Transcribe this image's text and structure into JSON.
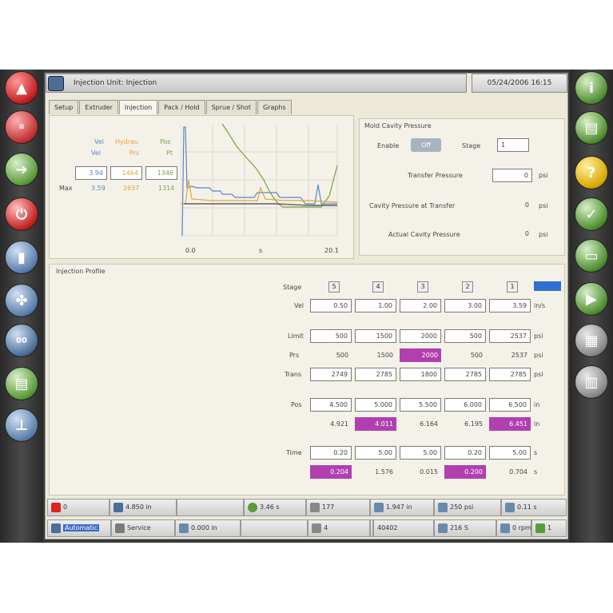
{
  "window": {
    "title": "Injection Unit: Injection",
    "datetime": "05/24/2006 16:15"
  },
  "tabs": [
    "Setup",
    "Extruder",
    "Injection",
    "Pack / Hold",
    "Sprue / Shot",
    "Graphs"
  ],
  "graph": {
    "legend_row1": [
      "Vel",
      "Hydrau",
      "Pos"
    ],
    "legend_row2": [
      "Vel",
      "Prs",
      "Pt"
    ],
    "values": [
      "3.94",
      "1464",
      "1346"
    ],
    "max_label": "Max",
    "max_values": [
      "3.59",
      "2637",
      "1314"
    ],
    "x_labels": [
      "0.0",
      "s",
      "20.1"
    ]
  },
  "cavity": {
    "title": "Mold Cavity Pressure",
    "enable_label": "Enable",
    "enable_value": "Off",
    "stage_label": "Stage",
    "stage_value": "1",
    "transfer_label": "Transfer Pressure",
    "transfer_value": "0",
    "transfer_unit": "psi",
    "at_transfer_label": "Cavity Pressure at Transfer",
    "at_transfer_value": "0",
    "at_transfer_unit": "psi",
    "actual_label": "Actual Cavity Pressure",
    "actual_value": "0",
    "actual_unit": "psi"
  },
  "profile": {
    "title": "Injection Profile",
    "stage_label": "Stage",
    "stages": [
      "5",
      "4",
      "3",
      "2",
      "1"
    ],
    "vel": {
      "label": "Vel",
      "unit": "in/s",
      "values": [
        "0.50",
        "1.00",
        "2.00",
        "3.00",
        "3.59"
      ]
    },
    "limit": {
      "label": "Limit",
      "unit": "psi",
      "values": [
        "500",
        "1500",
        "2000",
        "500",
        "2537"
      ]
    },
    "prs": {
      "label": "Prs",
      "unit": "psi",
      "values": [
        "500",
        "1500",
        "2000",
        "500",
        "2537"
      ]
    },
    "trans": {
      "label": "Trans",
      "unit": "psi",
      "values": [
        "2749",
        "2785",
        "1800",
        "2785",
        "2785"
      ]
    },
    "pos": {
      "label": "Pos",
      "unit": "in",
      "values": [
        "4.500",
        "5.000",
        "5.500",
        "6.000",
        "6.500"
      ]
    },
    "pos_actual": {
      "unit": "in",
      "values": [
        "4.921",
        "4.011",
        "6.164",
        "6.195",
        "6.451"
      ]
    },
    "time": {
      "label": "Time",
      "unit": "s",
      "values": [
        "0.20",
        "5.00",
        "5.00",
        "0.20",
        "5.00"
      ]
    },
    "time_actual": {
      "unit": "s",
      "values": [
        "0.204",
        "1.576",
        "0.015",
        "0.200",
        "0.704"
      ]
    }
  },
  "status_row1": [
    "0",
    "4.850 in",
    "3.46 s",
    "177",
    "1.947 in",
    "250 psi",
    "0.11 s"
  ],
  "status_row2": [
    "Automatic",
    "Service",
    "0.000 in",
    "4",
    "40402",
    "216 S",
    "0 rpm",
    "1"
  ],
  "colors": {
    "highlight": "#b23fb0",
    "panel": "#ece9d8",
    "graph_green": "#7aa04a",
    "graph_blue": "#5b87c5",
    "graph_orange": "#e3a33a"
  }
}
